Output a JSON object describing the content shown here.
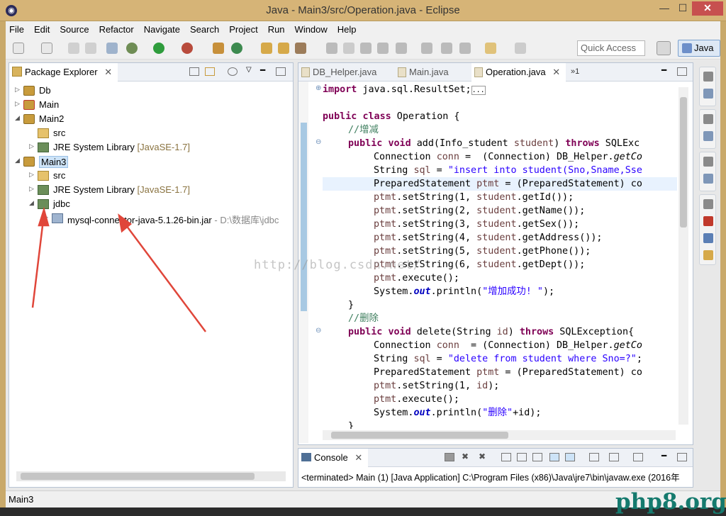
{
  "window": {
    "title": "Java - Main3/src/Operation.java - Eclipse",
    "app_icon": "eclipse-icon",
    "minimize": "—",
    "maximize": "☐",
    "close": "✕"
  },
  "menu": [
    "File",
    "Edit",
    "Source",
    "Refactor",
    "Navigate",
    "Search",
    "Project",
    "Run",
    "Window",
    "Help"
  ],
  "toolbar": {
    "quick_access_placeholder": "Quick Access",
    "perspective": "Java"
  },
  "package_explorer": {
    "title": "Package Explorer",
    "close": "✕",
    "tree": [
      {
        "label": "Db",
        "icon": "project-icon",
        "twisty": "▷"
      },
      {
        "label": "Main",
        "icon": "project-error-icon",
        "twisty": "▷"
      },
      {
        "label": "Main2",
        "icon": "project-icon",
        "twisty": "◢"
      },
      {
        "label": "src",
        "icon": "source-folder-icon"
      },
      {
        "label": "JRE System Library",
        "decoration": "[JavaSE-1.7]",
        "icon": "library-icon",
        "twisty": "▷"
      },
      {
        "label": "Main3",
        "icon": "project-icon",
        "twisty": "◢",
        "selected": true
      },
      {
        "label": "src",
        "icon": "source-folder-icon",
        "twisty": "▷"
      },
      {
        "label": "JRE System Library",
        "decoration": "[JavaSE-1.7]",
        "icon": "library-icon",
        "twisty": "▷"
      },
      {
        "label": "jdbc",
        "icon": "library-icon",
        "twisty": "◢"
      },
      {
        "label": "mysql-connector-java-5.1.26-bin.jar",
        "decoration": "- D:\\数据库\\jdbc",
        "icon": "jar-icon",
        "twisty": "▷"
      }
    ]
  },
  "editor": {
    "tabs": [
      {
        "label": "DB_Helper.java",
        "active": false
      },
      {
        "label": "Main.java",
        "active": false
      },
      {
        "label": "Operation.java",
        "active": true
      }
    ],
    "tab_close": "✕",
    "overflow": "»1",
    "code": {
      "l1": {
        "kw": "import",
        "rest": " java.sql.ResultSet;",
        "fold": "⊕",
        "box": "..."
      },
      "l3": {
        "kw1": "public",
        "kw2": "class",
        "rest": " Operation {"
      },
      "l4": {
        "comment": "//增减"
      },
      "l5": {
        "kw1": "public",
        "kw2": "void",
        "a": " add(Info_student ",
        "v": "student",
        "b": ") ",
        "kw3": "throws",
        "c": " SQLExc",
        "fold": "⊖"
      },
      "l6": {
        "a": "Connection ",
        "v": "conn",
        "b": " =  (Connection) DB_Helper.",
        "m": "getCo"
      },
      "l7": {
        "a": "String ",
        "v": "sql",
        "b": " = ",
        "s": "\"insert into student(Sno,Sname,Sse"
      },
      "l8": {
        "a": "PreparedStatement ",
        "v": "ptmt",
        "b": " = (PreparedStatement) co"
      },
      "l9": {
        "v1": "ptmt",
        "a": ".setString(1, ",
        "v2": "student",
        "b": ".getId());"
      },
      "l10": {
        "v1": "ptmt",
        "a": ".setString(2, ",
        "v2": "student",
        "b": ".getName());"
      },
      "l11": {
        "v1": "ptmt",
        "a": ".setString(3, ",
        "v2": "student",
        "b": ".getSex());"
      },
      "l12": {
        "v1": "ptmt",
        "a": ".setString(4, ",
        "v2": "student",
        "b": ".getAddress());"
      },
      "l13": {
        "v1": "ptmt",
        "a": ".setString(5, ",
        "v2": "student",
        "b": ".getPhone());"
      },
      "l14": {
        "v1": "ptmt",
        "a": ".setString(6, ",
        "v2": "student",
        "b": ".getDept());"
      },
      "l15": {
        "v1": "ptmt",
        "a": ".execute();"
      },
      "l16": {
        "a": "System.",
        "f": "out",
        "b": ".println(",
        "s": "\"增加成功! \"",
        "c": ");"
      },
      "l17": {
        "a": "}"
      },
      "l18": {
        "comment": "//删除"
      },
      "l19": {
        "kw1": "public",
        "kw2": "void",
        "a": " delete(String ",
        "v": "id",
        "b": ") ",
        "kw3": "throws",
        "c": " SQLException{",
        "fold": "⊖"
      },
      "l20": {
        "a": "Connection ",
        "v": "conn",
        "b": "  = (Connection) DB_Helper.",
        "m": "getCo"
      },
      "l21": {
        "a": "String ",
        "v": "sql",
        "b": " = ",
        "s": "\"delete from student where Sno=?\"",
        "c": ";"
      },
      "l22": {
        "a": "PreparedStatement ",
        "v": "ptmt",
        "b": " = (PreparedStatement) co"
      },
      "l23": {
        "v1": "ptmt",
        "a": ".setString(1, ",
        "v2": "id",
        "b": ");"
      },
      "l24": {
        "v1": "ptmt",
        "a": ".execute();"
      },
      "l25": {
        "a": "System.",
        "f": "out",
        "b": ".println(",
        "s": "\"删除\"",
        "c": "+id);"
      },
      "l26": {
        "a": "}"
      }
    }
  },
  "console": {
    "title": "Console",
    "close": "✕",
    "text": "<terminated> Main (1) [Java Application] C:\\Program Files (x86)\\Java\\jre7\\bin\\javaw.exe (2016年"
  },
  "status": {
    "text": "Main3"
  },
  "watermark": "http://blog.csdn.net/",
  "site_mark": "php8.org",
  "colors": {
    "keyword": "#7f0055",
    "string": "#2a00ff",
    "comment": "#3f7f5f",
    "field": "#0000c0",
    "variable": "#6a3e3e",
    "arrow": "#e0463a",
    "selection": "#cde3f7",
    "site_mark": "#157a6e"
  }
}
